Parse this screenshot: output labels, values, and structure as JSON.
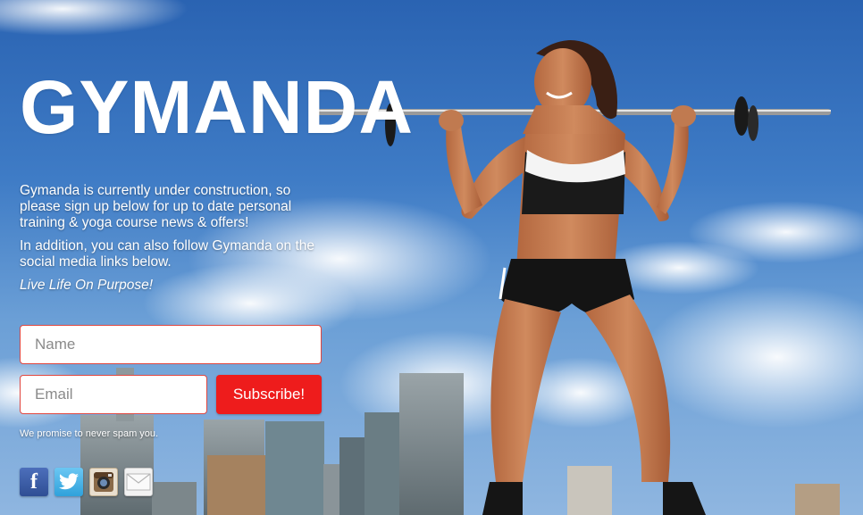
{
  "brand": {
    "title": "GYMANDA"
  },
  "intro": {
    "p1": "Gymanda is currently under construction, so please sign up below for up to date personal training & yoga course news & offers!",
    "p2": "In addition, you can also follow Gymanda on the social media links below.",
    "motto": "Live Life On Purpose!"
  },
  "form": {
    "name_placeholder": "Name",
    "email_placeholder": "Email",
    "subscribe_label": "Subscribe!",
    "note": "We promise to never spam you."
  },
  "social": {
    "facebook_glyph": "f",
    "icons": [
      "facebook-icon",
      "twitter-icon",
      "instagram-icon",
      "email-icon"
    ]
  },
  "colors": {
    "accent": "#ee1c1c",
    "sky": "#3f7cc6",
    "field_border": "#e0463f"
  }
}
